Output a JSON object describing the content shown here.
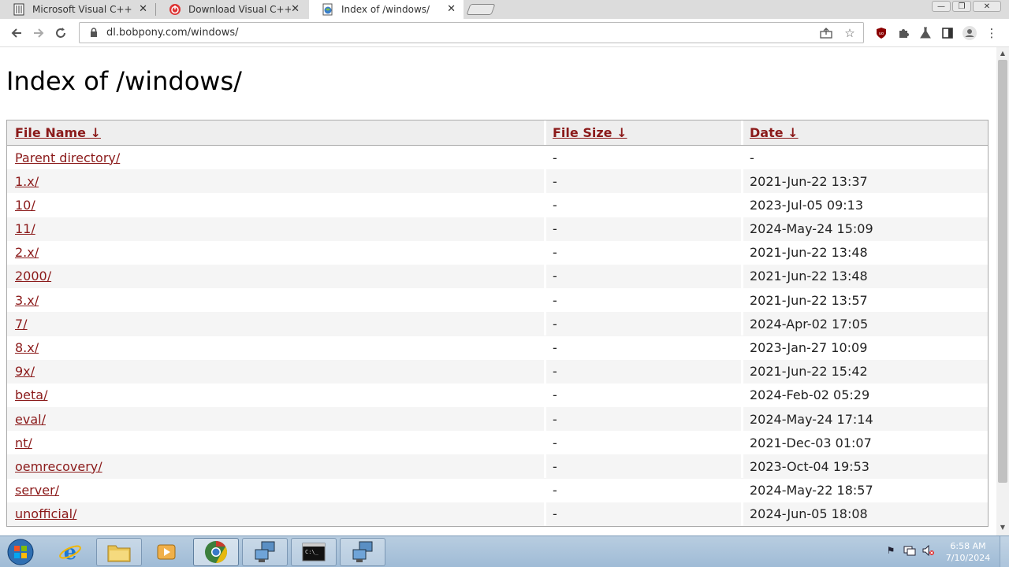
{
  "browser": {
    "tabs": [
      {
        "title": "Microsoft Visual C++ R",
        "icon": "document-icon"
      },
      {
        "title": "Download Visual C++ R",
        "icon": "red-power-icon"
      },
      {
        "title": "Index of /windows/",
        "icon": "globe-page-icon"
      }
    ],
    "close_glyph": "✕",
    "url": "dl.bobpony.com/windows/"
  },
  "page": {
    "title": "Index of /windows/",
    "columns": {
      "name": "File Name  ↓",
      "size": "File Size  ↓",
      "date": "Date  ↓"
    },
    "rows": [
      {
        "name": "Parent directory/",
        "size": "-",
        "date": "-"
      },
      {
        "name": "1.x/",
        "size": "-",
        "date": "2021-Jun-22 13:37"
      },
      {
        "name": "10/",
        "size": "-",
        "date": "2023-Jul-05 09:13"
      },
      {
        "name": "11/",
        "size": "-",
        "date": "2024-May-24 15:09"
      },
      {
        "name": "2.x/",
        "size": "-",
        "date": "2021-Jun-22 13:48"
      },
      {
        "name": "2000/",
        "size": "-",
        "date": "2021-Jun-22 13:48"
      },
      {
        "name": "3.x/",
        "size": "-",
        "date": "2021-Jun-22 13:57"
      },
      {
        "name": "7/",
        "size": "-",
        "date": "2024-Apr-02 17:05"
      },
      {
        "name": "8.x/",
        "size": "-",
        "date": "2023-Jan-27 10:09"
      },
      {
        "name": "9x/",
        "size": "-",
        "date": "2021-Jun-22 15:42"
      },
      {
        "name": "beta/",
        "size": "-",
        "date": "2024-Feb-02 05:29"
      },
      {
        "name": "eval/",
        "size": "-",
        "date": "2024-May-24 17:14"
      },
      {
        "name": "nt/",
        "size": "-",
        "date": "2021-Dec-03 01:07"
      },
      {
        "name": "oemrecovery/",
        "size": "-",
        "date": "2023-Oct-04 19:53"
      },
      {
        "name": "server/",
        "size": "-",
        "date": "2024-May-22 18:57"
      },
      {
        "name": "unofficial/",
        "size": "-",
        "date": "2024-Jun-05 18:08"
      }
    ]
  },
  "taskbar": {
    "time": "6:58 AM",
    "date": "7/10/2024"
  },
  "colors": {
    "link": "#8b1a1a",
    "header_bg": "#eeeeee",
    "taskbar": "#a9c2d9"
  }
}
